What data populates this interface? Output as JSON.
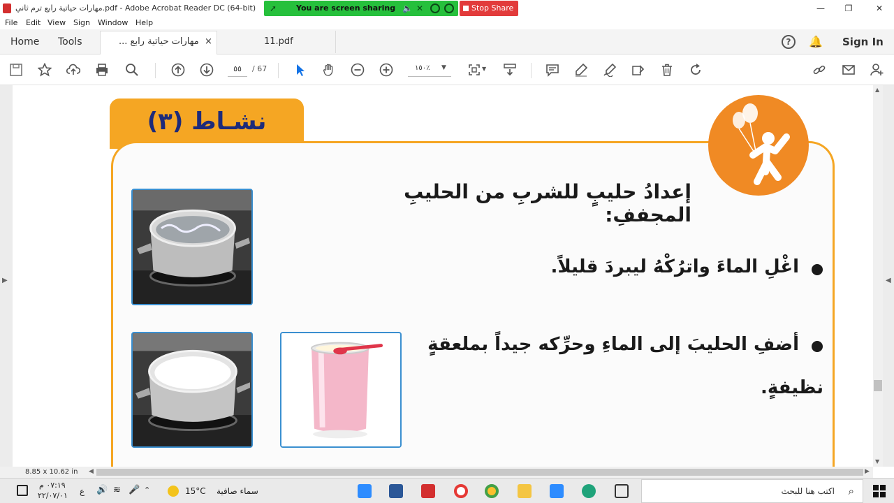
{
  "window": {
    "title": "مهارات حياتية رابع ترم ثاني.pdf - Adobe Acrobat Reader DC (64-bit)"
  },
  "screen_share": {
    "status_text": "You are screen sharing",
    "stop_label": "Stop Share"
  },
  "menu": {
    "items": [
      "File",
      "Edit",
      "View",
      "Sign",
      "Window",
      "Help"
    ]
  },
  "tabs": {
    "home": "Home",
    "tools": "Tools",
    "doc1": "مهارات حياتية رابع ...",
    "doc1_close": "×",
    "doc2": "11.pdf",
    "sign_in": "Sign In"
  },
  "toolbar": {
    "page_current": "٥٥",
    "page_total": "/ 67",
    "zoom": "١٥٠٪"
  },
  "document": {
    "activity_title": "نشـاط (٣)",
    "heading": "إعدادُ حليبٍ للشربِ من الحليبِ المجففِ:",
    "bullet1": "اغْلِ الماءَ واترُكْهُ ليبردَ قليلاً.",
    "bullet2_line1": "أضفِ الحليبَ إلى الماءِ وحرِّكه جيداً بملعقةٍ",
    "bullet2_line2": "نظيفةٍ."
  },
  "status": {
    "page_size": "8.85 x 10.62 in"
  },
  "taskbar": {
    "search_placeholder": "اكتب هنا للبحث",
    "weather_temp": "15°C",
    "weather_text": "سماء صافية",
    "time": "٠٧:١٩ م",
    "date": "٢٢/٠٧/٠١",
    "lang": "ع"
  },
  "colors": {
    "share_green": "#26c03c",
    "stop_red": "#e23b3b",
    "activity_orange": "#f5a623",
    "title_blue": "#1d2b7a",
    "photo_border": "#3a8fd0"
  }
}
